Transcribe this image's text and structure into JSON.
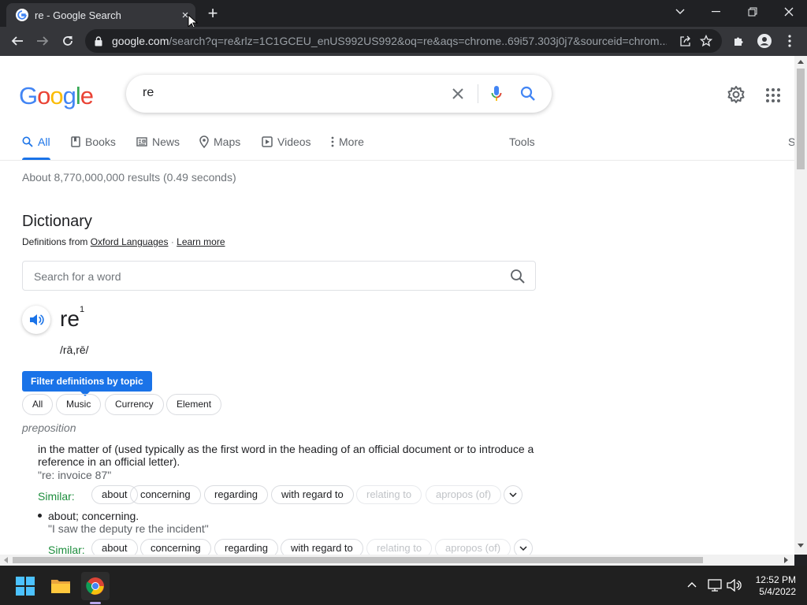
{
  "tab": {
    "title": "re - Google Search",
    "close": "×"
  },
  "toolbar": {
    "url_host": "google.com",
    "url_rest": "/search?q=re&rlz=1C1GCEU_enUS992US992&oq=re&aqs=chrome..69i57.303j0j7&sourceid=chrom..."
  },
  "search": {
    "query": "re"
  },
  "nav_tabs": [
    {
      "label": "All",
      "icon": "search-icon"
    },
    {
      "label": "Books",
      "icon": "book-icon"
    },
    {
      "label": "News",
      "icon": "news-icon"
    },
    {
      "label": "Maps",
      "icon": "map-pin-icon"
    },
    {
      "label": "Videos",
      "icon": "video-icon"
    },
    {
      "label": "More",
      "icon": "more-vertical-icon"
    }
  ],
  "tools_label": "Tools",
  "right_cutoff": "S",
  "result_stats": "About 8,770,000,000 results (0.49 seconds)",
  "dictionary": {
    "title": "Dictionary",
    "from_prefix": "Definitions from",
    "source": "Oxford Languages",
    "dot": "·",
    "learn_more": "Learn more",
    "search_placeholder": "Search for a word",
    "headword": "re",
    "superscript": "1",
    "pronunciation": "/rā,rē/",
    "filter_label": "Filter definitions by topic",
    "topic_chips": [
      "All",
      "Music",
      "Currency",
      "Element"
    ],
    "part_of_speech": "preposition",
    "definitions": [
      {
        "text": "in the matter of (used typically as the first word in the heading of an official document or to introduce a reference in an official letter).",
        "example": "\"re: invoice 87\"",
        "similar_label": "Similar:",
        "similar": [
          "about",
          "concerning",
          "regarding",
          "with regard to",
          "relating to",
          "apropos (of)"
        ]
      },
      {
        "text": "about; concerning.",
        "example": "\"I saw the deputy re the incident\"",
        "similar_label": "Similar:",
        "similar": [
          "about",
          "concerning",
          "regarding",
          "with regard to",
          "relating to",
          "apropos (of)"
        ]
      }
    ]
  },
  "taskbar": {
    "time": "12:52 PM",
    "date": "5/4/2022"
  },
  "colors": {
    "accent": "#1a73e8",
    "similar_green": "#1e8e3e"
  }
}
